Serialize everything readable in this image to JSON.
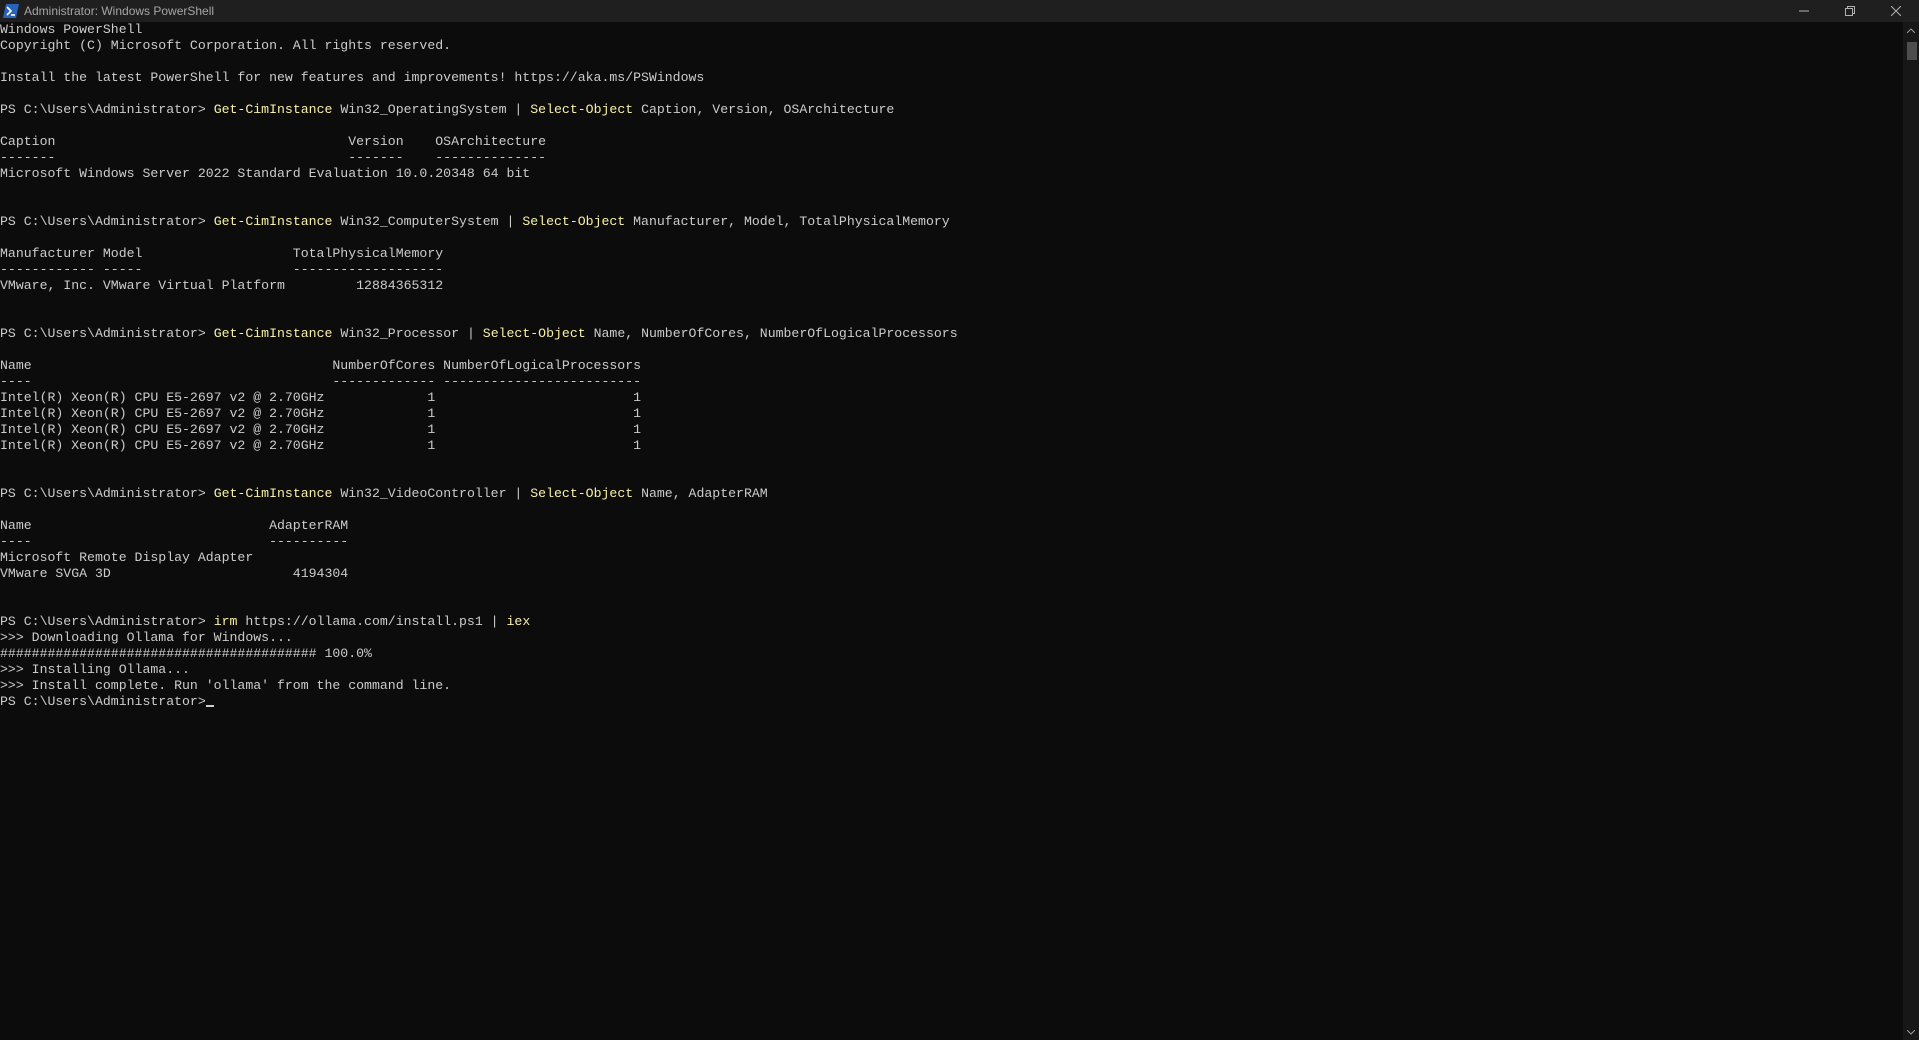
{
  "window": {
    "title": "Administrator: Windows PowerShell",
    "controls": [
      "minimize",
      "restore",
      "close"
    ]
  },
  "console": {
    "banner": [
      "Windows PowerShell",
      "Copyright (C) Microsoft Corporation. All rights reserved.",
      "",
      "Install the latest PowerShell for new features and improvements! https://aka.ms/PSWindows"
    ],
    "prompt": "PS C:\\Users\\Administrator> ",
    "blocks": [
      {
        "cmd_name": "Get-CimInstance",
        "cmd_arg": " Win32_OperatingSystem | ",
        "cmd_pipe": "Select-Object",
        "cmd_rest": " Caption, Version, OSArchitecture",
        "output": [
          "",
          "Caption                                     Version    OSArchitecture",
          "-------                                     -------    --------------",
          "Microsoft Windows Server 2022 Standard Evaluation 10.0.20348 64 bit",
          "",
          ""
        ]
      },
      {
        "cmd_name": "Get-CimInstance",
        "cmd_arg": " Win32_ComputerSystem | ",
        "cmd_pipe": "Select-Object",
        "cmd_rest": " Manufacturer, Model, TotalPhysicalMemory",
        "output": [
          "",
          "Manufacturer Model                   TotalPhysicalMemory",
          "------------ -----                   -------------------",
          "VMware, Inc. VMware Virtual Platform         12884365312",
          "",
          ""
        ]
      },
      {
        "cmd_name": "Get-CimInstance",
        "cmd_arg": " Win32_Processor | ",
        "cmd_pipe": "Select-Object",
        "cmd_rest": " Name, NumberOfCores, NumberOfLogicalProcessors",
        "output": [
          "",
          "Name                                      NumberOfCores NumberOfLogicalProcessors",
          "----                                      ------------- -------------------------",
          "Intel(R) Xeon(R) CPU E5-2697 v2 @ 2.70GHz             1                         1",
          "Intel(R) Xeon(R) CPU E5-2697 v2 @ 2.70GHz             1                         1",
          "Intel(R) Xeon(R) CPU E5-2697 v2 @ 2.70GHz             1                         1",
          "Intel(R) Xeon(R) CPU E5-2697 v2 @ 2.70GHz             1                         1",
          "",
          ""
        ]
      },
      {
        "cmd_name": "Get-CimInstance",
        "cmd_arg": " Win32_VideoController | ",
        "cmd_pipe": "Select-Object",
        "cmd_rest": " Name, AdapterRAM",
        "output": [
          "",
          "Name                              AdapterRAM",
          "----                              ----------",
          "Microsoft Remote Display Adapter",
          "VMware SVGA 3D                       4194304",
          "",
          ""
        ]
      },
      {
        "cmd_name": "irm",
        "cmd_arg": " https://ollama.com/install.ps1 | ",
        "cmd_pipe": "iex",
        "cmd_rest": "",
        "output": [
          ">>> Downloading Ollama for Windows...",
          "######################################## 100.0%",
          ">>> Installing Ollama...",
          ">>> Install complete. Run 'ollama' from the command line."
        ]
      }
    ],
    "final_prompt": "PS C:\\Users\\Administrator>"
  },
  "colors": {
    "background": "#0c0c0c",
    "text": "#cccccc",
    "command": "#f9f1a5",
    "titlebar": "#1f1f1f"
  }
}
